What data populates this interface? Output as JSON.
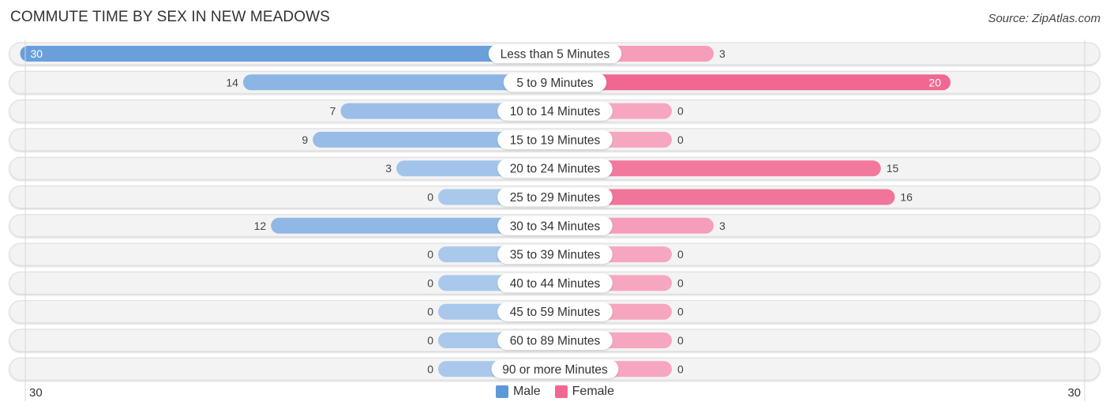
{
  "title": "COMMUTE TIME BY SEX IN NEW MEADOWS",
  "source": "Source: ZipAtlas.com",
  "colors": {
    "male": "#6a9fdc",
    "male_light": "#a9c8ec",
    "female": "#f06892",
    "female_light": "#f7a6c0",
    "row_bg": "#f3f3f3",
    "row_border": "#dddddd"
  },
  "legend": [
    {
      "label": "Male",
      "color": "#5f98d8"
    },
    {
      "label": "Female",
      "color": "#f06892"
    }
  ],
  "axis": {
    "left_label": "30",
    "right_label": "30"
  },
  "chart_data": {
    "type": "bar",
    "orientation": "horizontal-diverging",
    "title": "COMMUTE TIME BY SEX IN NEW MEADOWS",
    "categories": [
      "Less than 5 Minutes",
      "5 to 9 Minutes",
      "10 to 14 Minutes",
      "15 to 19 Minutes",
      "20 to 24 Minutes",
      "25 to 29 Minutes",
      "30 to 34 Minutes",
      "35 to 39 Minutes",
      "40 to 44 Minutes",
      "45 to 59 Minutes",
      "60 to 89 Minutes",
      "90 or more Minutes"
    ],
    "series": [
      {
        "name": "Male",
        "values": [
          30,
          14,
          7,
          9,
          3,
          0,
          12,
          0,
          0,
          0,
          0,
          0
        ]
      },
      {
        "name": "Female",
        "values": [
          3,
          20,
          0,
          0,
          15,
          16,
          3,
          0,
          0,
          0,
          0,
          0
        ]
      }
    ],
    "xlim": [
      -30,
      30
    ],
    "xtick_labels": [
      "30",
      "30"
    ],
    "legend_position": "bottom-center",
    "grid": false
  }
}
